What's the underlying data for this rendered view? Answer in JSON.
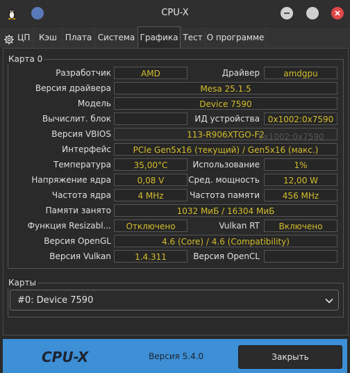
{
  "window": {
    "title": "CPU-X"
  },
  "tabs": [
    {
      "label": "ЦП"
    },
    {
      "label": "Кэш"
    },
    {
      "label": "Плата"
    },
    {
      "label": "Система"
    },
    {
      "label": "Графика"
    },
    {
      "label": "Тест"
    },
    {
      "label": "О программе"
    }
  ],
  "card": {
    "group_title": "Карта 0",
    "vendor_label": "Разработчик",
    "vendor_value": "AMD",
    "driver_label": "Драйвер",
    "driver_value": "amdgpu",
    "driver_version_label": "Версия драйвера",
    "driver_version_value": "Mesa 25.1.5",
    "model_label": "Модель",
    "model_value": "Device 7590",
    "compute_unit_label": "Вычислит. блок",
    "compute_unit_value": "",
    "device_id_label": "ИД устройства",
    "device_id_value": "0x1002:0x7590",
    "vbios_label": "Версия VBIOS",
    "vbios_value": "113-R906XTGO-F2",
    "ghost_text": "0x1002:0x7590",
    "interface_label": "Интерфейс",
    "interface_value": "PCIe Gen5x16 (текущий) / Gen5x16 (макс.)",
    "temperature_label": "Температура",
    "temperature_value": "35,00°C",
    "usage_label": "Использование",
    "usage_value": "1%",
    "core_voltage_label": "Напряжение ядра",
    "core_voltage_value": "0,08 V",
    "avg_power_label": "Сред. мощность",
    "avg_power_value": "12,00 W",
    "core_freq_label": "Частота ядра",
    "core_freq_value": "4 MHz",
    "mem_freq_label": "Частота памяти",
    "mem_freq_value": "456 MHz",
    "mem_used_label": "Памяти занято",
    "mem_used_value": "1032 МиБ / 16304 МиБ",
    "resizable_bar_label": "Функция Resizabl...",
    "resizable_bar_value": "Отключено",
    "vulkan_rt_label": "Vulkan RT",
    "vulkan_rt_value": "Включено",
    "opengl_label": "Версия OpenGL",
    "opengl_value": "4.6 (Core) / 4.6 (Compatibility)",
    "vulkan_label": "Версия Vulkan",
    "vulkan_value": "1.4.311",
    "opencl_label": "Версия OpenCL",
    "opencl_value": ""
  },
  "cards": {
    "group_title": "Карты",
    "selected": "#0: Device 7590"
  },
  "footer": {
    "brand": "CPU-X",
    "version": "Версия 5.4.0",
    "close_label": "Закрыть"
  },
  "colors": {
    "value_text": "#d4bd2c",
    "footer_bg": "#3d8fd6",
    "minimize_dot": "#d0d0d0",
    "close_dot": "#e04848"
  }
}
